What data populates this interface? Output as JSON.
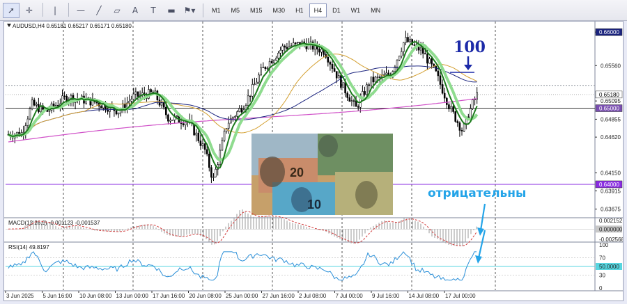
{
  "toolbar": {
    "tools": [
      {
        "icon": "cursor-icon",
        "glyph": "➚"
      },
      {
        "icon": "crosshair-icon",
        "glyph": "✛"
      },
      {
        "icon": "vertical-line-icon",
        "glyph": "|"
      },
      {
        "icon": "horizontal-line-icon",
        "glyph": "—"
      },
      {
        "icon": "trendline-icon",
        "glyph": "╱"
      },
      {
        "icon": "channel-icon",
        "glyph": "▱"
      },
      {
        "icon": "text-icon",
        "glyph": "A"
      },
      {
        "icon": "text-label-icon",
        "glyph": "T"
      },
      {
        "icon": "shapes-icon",
        "glyph": "▬"
      },
      {
        "icon": "more-tools-icon",
        "glyph": "⚑▾"
      }
    ],
    "timeframes": [
      "M1",
      "M5",
      "M15",
      "M30",
      "H1",
      "H4",
      "D1",
      "W1",
      "MN"
    ],
    "active_timeframe": "H4"
  },
  "chart": {
    "header": "AUDUSD,H4  0.65181 0.65217 0.65171 0.65180",
    "price_labels": [
      {
        "text": "0.66000",
        "price": 0.66
      },
      {
        "text": "0.65560",
        "price": 0.6556
      },
      {
        "text": "0.65095",
        "price": 0.65095
      },
      {
        "text": "0.64855",
        "price": 0.64855
      },
      {
        "text": "0.64620",
        "price": 0.6462
      },
      {
        "text": "0.64150",
        "price": 0.6415
      },
      {
        "text": "0.63915",
        "price": 0.63915
      },
      {
        "text": "0.63675",
        "price": 0.63675
      }
    ],
    "price_tags": [
      {
        "text": "0.66000",
        "price": 0.66,
        "bg": "#1a237e",
        "fg": "#ffffff"
      },
      {
        "text": "0.65180",
        "price": 0.6518,
        "bg": "#ffffff",
        "fg": "#000000"
      },
      {
        "text": "0.65000",
        "price": 0.65,
        "bg": "#7a4fb0",
        "fg": "#ffffff"
      },
      {
        "text": "0.64000",
        "price": 0.64,
        "bg": "#8a2be2",
        "fg": "#ffffff"
      }
    ],
    "time_labels": [
      "3 Jun 2025",
      "5 Jun 16:00",
      "10 Jun 08:00",
      "13 Jun 00:00",
      "17 Jun 16:00",
      "20 Jun 08:00",
      "25 Jun 00:00",
      "27 Jun 16:00",
      "2 Jul 08:00",
      "7 Jul 00:00",
      "9 Jul 16:00",
      "14 Jul 08:00",
      "17 Jul 00:00"
    ]
  },
  "annotations": {
    "label_100": "100",
    "label_negative": "отрицательны"
  },
  "macd": {
    "header": "MACD(12,26,9) -0.001123 -0.001537",
    "labels": [
      {
        "text": "0.002152",
        "value": 0.002152
      },
      {
        "text": "0.000000",
        "value": 0.0
      },
      {
        "text": "-0.002568",
        "value": -0.002568
      }
    ]
  },
  "rsi": {
    "header": "RSI(14) 49.8197",
    "labels": [
      {
        "text": "100",
        "value": 100
      },
      {
        "text": "70",
        "value": 70
      },
      {
        "text": "50.0000",
        "value": 50
      },
      {
        "text": "30",
        "value": 30
      },
      {
        "text": "0",
        "value": 0
      }
    ]
  },
  "colors": {
    "grid_dash": "#555555",
    "ma_green": "#1b7a1b",
    "ma_lightgreen": "#8fdc8f",
    "ma_orange": "#d4a032",
    "ma_navy": "#1a237e",
    "ma_magenta": "#d050c8",
    "level_purple": "#8a2be2",
    "rsi_line": "#2a8fd8",
    "rsi_level": "#57d6e0",
    "arrow_blue": "#1c2aa8",
    "arrow_lightblue": "#24a4e8"
  }
}
